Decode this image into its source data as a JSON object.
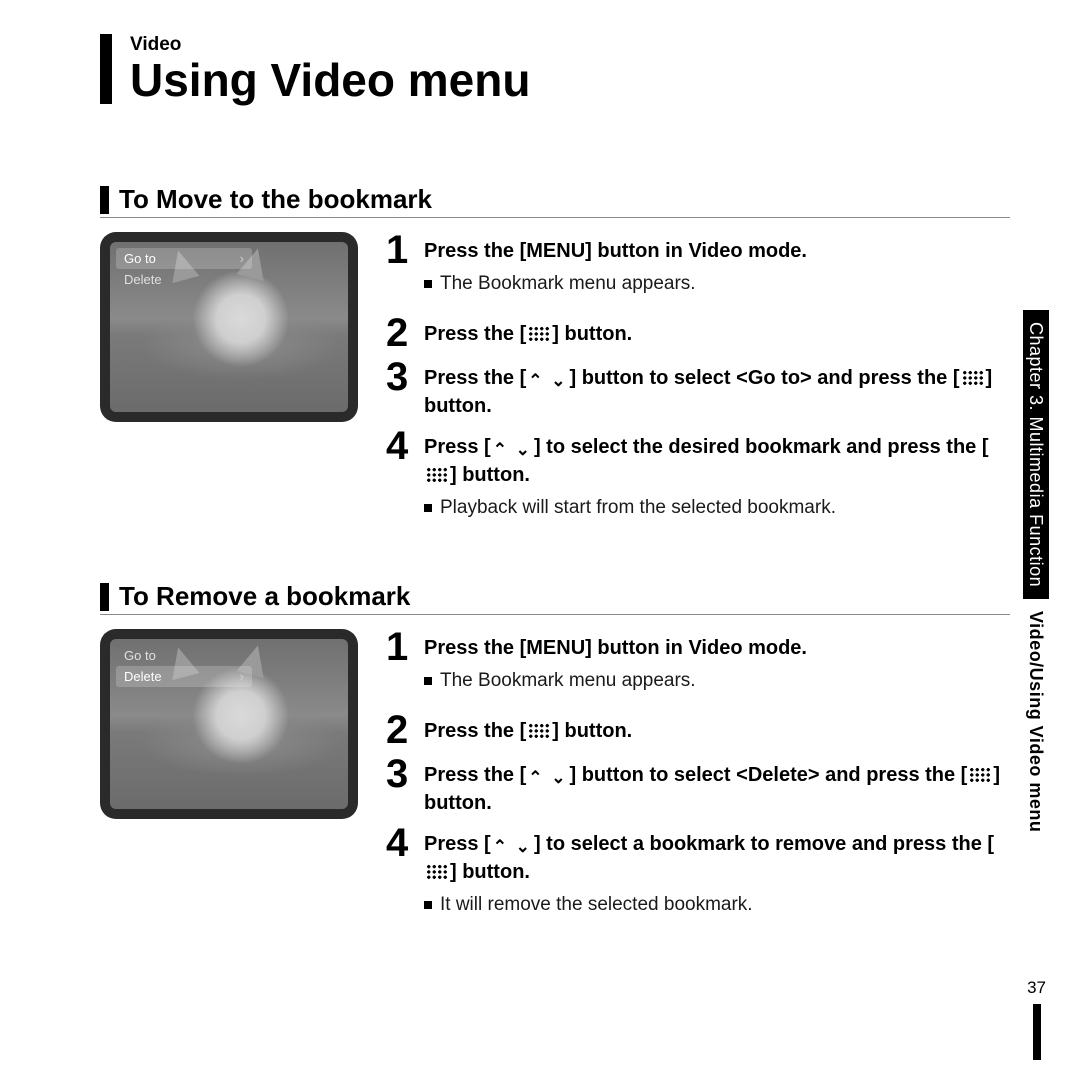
{
  "header": {
    "category": "Video",
    "title": "Using Video menu"
  },
  "side_tab": {
    "chapter": "Chapter 3. Multimedia Function",
    "breadcrumb": "Video/Using Video menu"
  },
  "page_number": "37",
  "sections": [
    {
      "heading": "To Move to the bookmark",
      "menu_selected_index": 0,
      "menu_items": [
        "Go to",
        "Delete"
      ],
      "steps": [
        {
          "num": "1",
          "title_parts": [
            "Press the [MENU] button in Video mode."
          ],
          "note": "The Bookmark menu appears."
        },
        {
          "num": "2",
          "title_parts": [
            "Press the [",
            "GRID",
            "] button."
          ]
        },
        {
          "num": "3",
          "title_parts": [
            "Press the [",
            "UPDOWN",
            "] button to select <Go to> and press the [",
            "GRID",
            "] button."
          ]
        },
        {
          "num": "4",
          "title_parts": [
            "Press [",
            "UPDOWN",
            "] to select the desired bookmark and press the [",
            "GRID",
            "] button."
          ],
          "note": "Playback will start from the selected bookmark."
        }
      ]
    },
    {
      "heading": "To Remove a bookmark",
      "menu_selected_index": 1,
      "menu_items": [
        "Go to",
        "Delete"
      ],
      "steps": [
        {
          "num": "1",
          "title_parts": [
            "Press the [MENU] button in Video mode."
          ],
          "note": "The Bookmark menu appears."
        },
        {
          "num": "2",
          "title_parts": [
            "Press the [",
            "GRID",
            "] button."
          ]
        },
        {
          "num": "3",
          "title_parts": [
            "Press the [",
            "UPDOWN",
            "] button to select <Delete> and press the [",
            "GRID",
            "] button."
          ]
        },
        {
          "num": "4",
          "title_parts": [
            "Press [",
            "UPDOWN",
            "] to select a bookmark to remove and press the [",
            "GRID",
            "] button."
          ],
          "note": "It will remove the selected bookmark."
        }
      ]
    }
  ]
}
